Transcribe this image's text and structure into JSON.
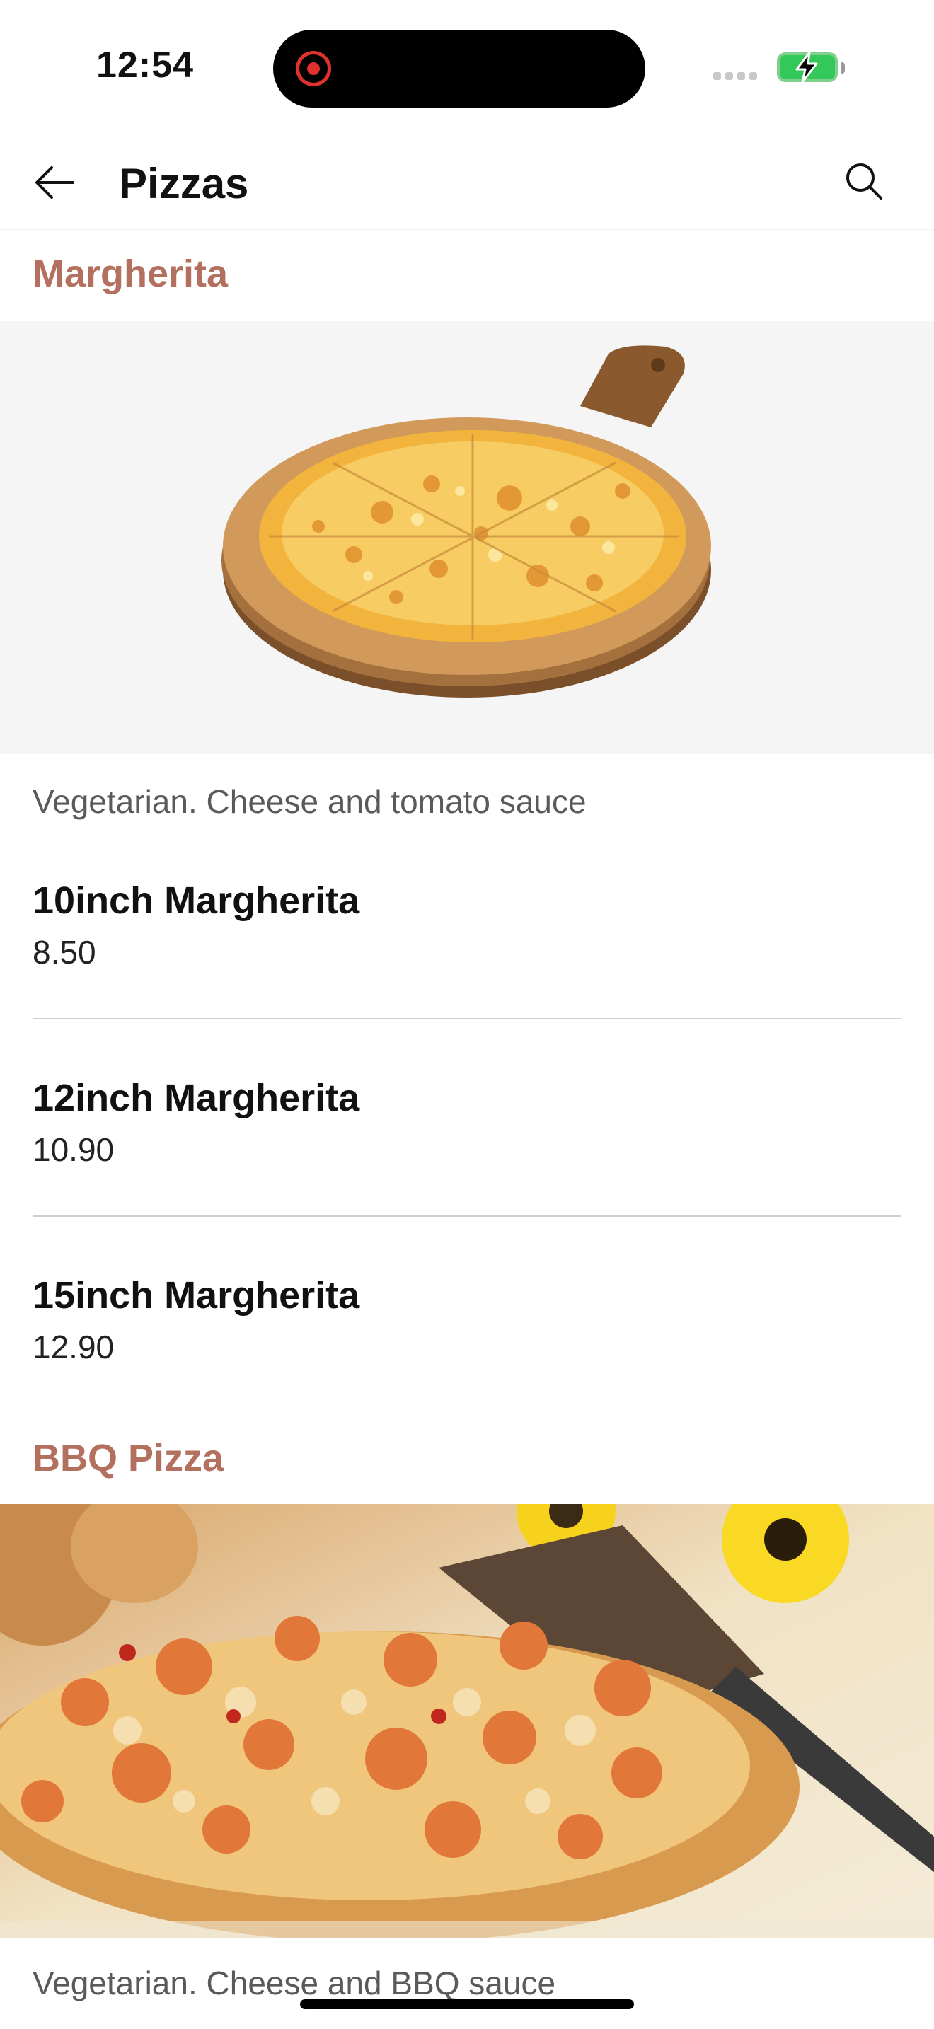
{
  "status_bar": {
    "time": "12:54",
    "recording_icon": "screen-record-icon",
    "battery_icon": "battery-charging-icon",
    "signal_icon": "cellular-signal-icon",
    "battery_color": "#34c759",
    "record_color": "#e0322c"
  },
  "header": {
    "title": "Pizzas",
    "back_icon": "arrow-left-icon",
    "search_icon": "search-icon"
  },
  "theme": {
    "section_title_color": "#b3705f",
    "divider_color": "#cfcfcf"
  },
  "sections": [
    {
      "title": "Margherita",
      "image": "margherita-pizza-image",
      "description": "Vegetarian. Cheese and tomato sauce",
      "items": [
        {
          "name": "10inch Margherita",
          "price": "8.50"
        },
        {
          "name": "12inch Margherita",
          "price": "10.90"
        },
        {
          "name": "15inch Margherita",
          "price": "12.90"
        }
      ]
    },
    {
      "title": "BBQ Pizza",
      "image": "bbq-pizza-image",
      "description": "Vegetarian. Cheese and BBQ sauce"
    }
  ]
}
